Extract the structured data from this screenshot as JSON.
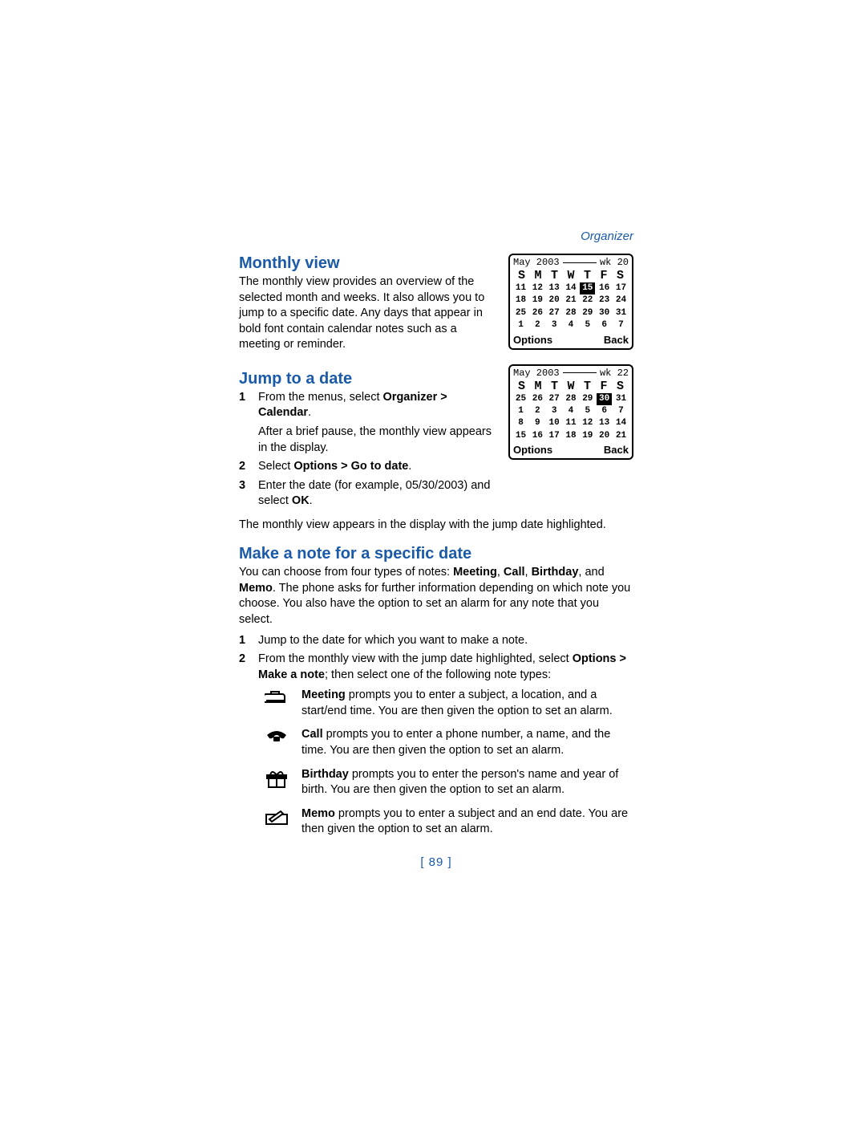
{
  "header": {
    "section": "Organizer"
  },
  "section1": {
    "title": "Monthly view",
    "body": "The monthly view provides an overview of the selected month and weeks. It also allows you to jump to a specific date. Any days that appear in bold font contain calendar notes such as a meeting or reminder."
  },
  "section2": {
    "title": "Jump to a date",
    "steps": {
      "n1": "1",
      "s1a": "From the menus, select ",
      "s1b": "Organizer > Calendar",
      "s1c": ".",
      "s1sub": "After a brief pause, the monthly view appears in the display.",
      "n2": "2",
      "s2a": "Select ",
      "s2b": "Options > Go to date",
      "s2c": ".",
      "n3": "3",
      "s3a": "Enter the date (for example, 05/30/2003) and select ",
      "s3b": "OK",
      "s3c": "."
    },
    "after": "The monthly view appears in the display with the jump date highlighted."
  },
  "section3": {
    "title": "Make a note for a specific date",
    "intro_a": "You can choose from four types of notes: ",
    "intro_b": "Meeting",
    "intro_c": ", ",
    "intro_d": "Call",
    "intro_e": ", ",
    "intro_f": "Birthday",
    "intro_g": ", and ",
    "intro_h": "Memo",
    "intro_i": ". The phone asks for further information depending on which note you choose. You also have the option to set an alarm for any note that you select.",
    "steps": {
      "n1": "1",
      "s1": "Jump to the date for which you want to make a note.",
      "n2": "2",
      "s2a": "From the monthly view with the jump date highlighted, select ",
      "s2b": "Options > Make a note",
      "s2c": "; then select one of the following note types:"
    },
    "notes": {
      "meeting_b": "Meeting",
      "meeting_t": " prompts you to enter a subject, a location, and a start/end time. You are then given the option to set an alarm.",
      "call_b": "Call",
      "call_t": " prompts you to enter a phone number, a name, and the time. You are then given the option to set an alarm.",
      "birthday_b": "Birthday",
      "birthday_t": " prompts you to enter the person's name and year of birth. You are then given the option to set an alarm.",
      "memo_b": "Memo",
      "memo_t": " prompts you to enter a subject and an end date. You are then given the option to set an alarm."
    }
  },
  "screens": {
    "days": [
      "S",
      "M",
      "T",
      "W",
      "T",
      "F",
      "S"
    ],
    "options": "Options",
    "back": "Back",
    "screen1": {
      "month": "May 2003",
      "week": "wk 20",
      "rows": [
        [
          "11",
          "12",
          "13",
          "14",
          "15",
          "16",
          "17"
        ],
        [
          "18",
          "19",
          "20",
          "21",
          "22",
          "23",
          "24"
        ],
        [
          "25",
          "26",
          "27",
          "28",
          "29",
          "30",
          "31"
        ],
        [
          "1",
          "2",
          "3",
          "4",
          "5",
          "6",
          "7"
        ]
      ],
      "highlight_row": 0,
      "highlight_col": 4
    },
    "screen2": {
      "month": "May 2003",
      "week": "wk 22",
      "rows": [
        [
          "25",
          "26",
          "27",
          "28",
          "29",
          "30",
          "31"
        ],
        [
          "1",
          "2",
          "3",
          "4",
          "5",
          "6",
          "7"
        ],
        [
          "8",
          "9",
          "10",
          "11",
          "12",
          "13",
          "14"
        ],
        [
          "15",
          "16",
          "17",
          "18",
          "19",
          "20",
          "21"
        ]
      ],
      "highlight_row": 0,
      "highlight_col": 5
    }
  },
  "footer": {
    "page": "[ 89 ]"
  }
}
